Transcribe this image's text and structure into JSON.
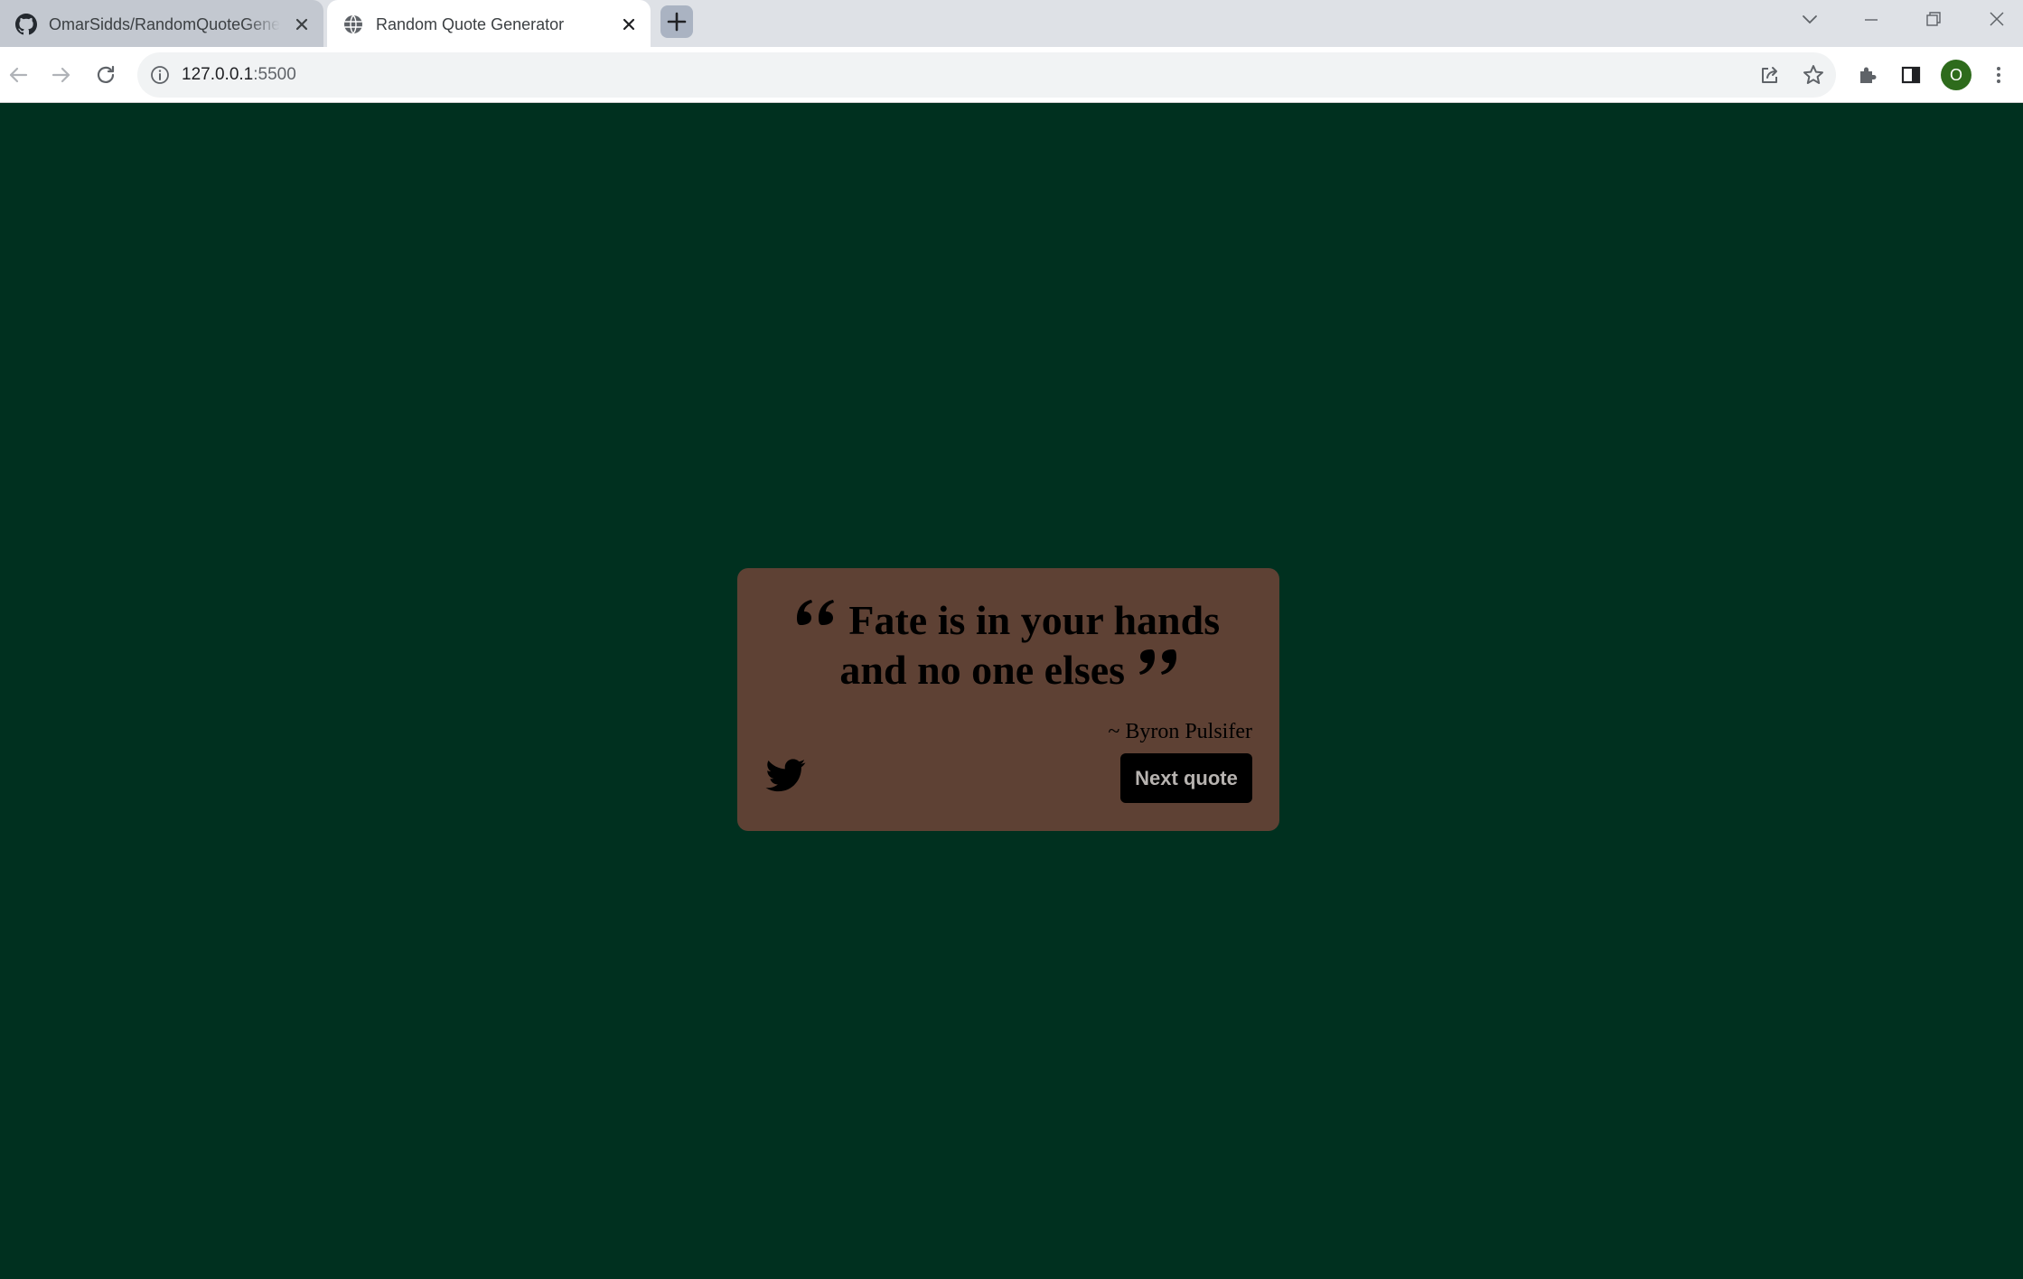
{
  "browser": {
    "tabs": [
      {
        "title": "OmarSidds/RandomQuoteGenerator",
        "favicon": "github-icon",
        "active": false
      },
      {
        "title": "Random Quote Generator",
        "favicon": "globe-icon",
        "active": true
      }
    ],
    "address_bar": {
      "host": "127.0.0.1",
      "port": ":5500"
    },
    "profile_initial": "O"
  },
  "quote_card": {
    "quote": "Fate is in your hands and no one elses",
    "author": "~ Byron Pulsifer",
    "next_button_label": "Next quote",
    "share_icon": "twitter-icon"
  },
  "colors": {
    "page_background": "#00301f",
    "card_background": "#5e4134",
    "button_background": "#000000",
    "button_text": "#b7b3b0",
    "text": "#000000"
  }
}
